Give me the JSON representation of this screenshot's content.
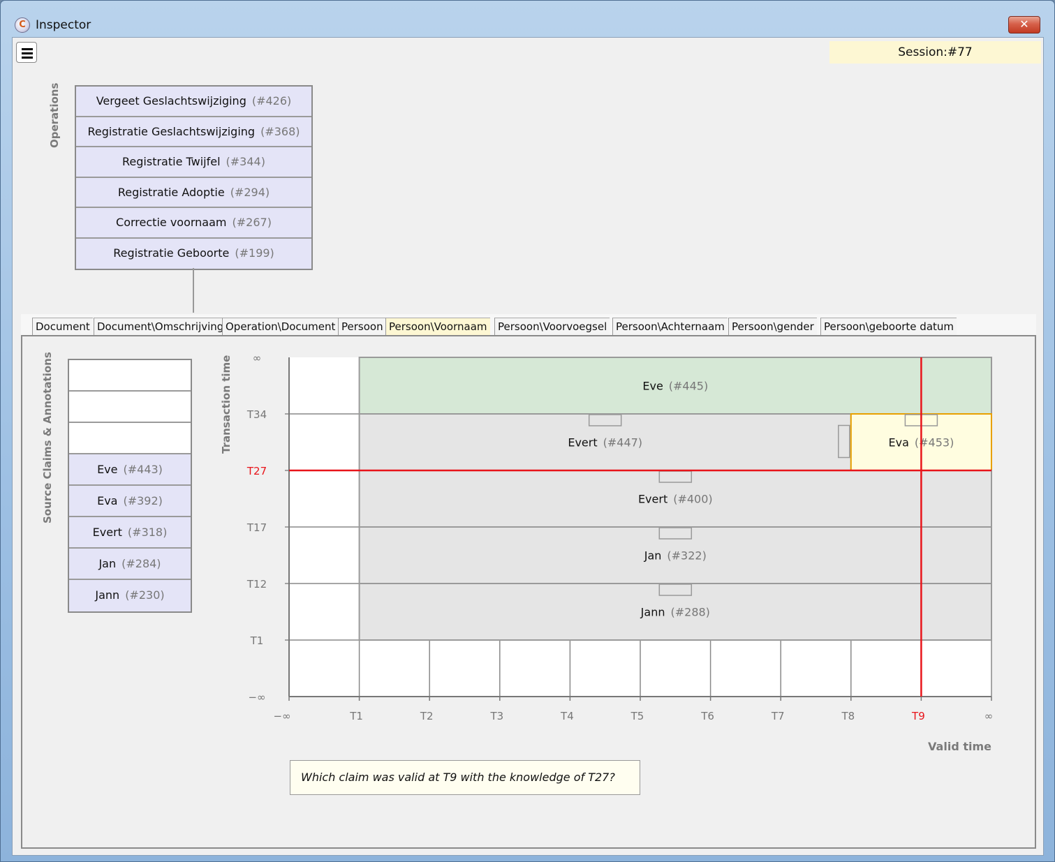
{
  "window": {
    "title": "Inspector",
    "app_icon_glyph": "C",
    "close_glyph": "✕"
  },
  "toolbar": {
    "menu_icon": "hamburger-menu-icon",
    "session": "Session:#77"
  },
  "operations": {
    "label": "Operations",
    "items": [
      {
        "name": "Vergeet Geslachtswijziging",
        "ref": "(#426)"
      },
      {
        "name": "Registratie Geslachtswijziging",
        "ref": "(#368)"
      },
      {
        "name": "Registratie Twijfel",
        "ref": "(#344)"
      },
      {
        "name": "Registratie Adoptie",
        "ref": "(#294)"
      },
      {
        "name": "Correctie voornaam",
        "ref": "(#267)"
      },
      {
        "name": "Registratie Geboorte",
        "ref": "(#199)"
      }
    ]
  },
  "tabs": [
    {
      "label": "Document",
      "active": false
    },
    {
      "label": "Document\\Omschrijving",
      "active": false
    },
    {
      "label": "Operation\\Document",
      "active": false
    },
    {
      "label": "Persoon",
      "active": false
    },
    {
      "label": "Persoon\\Voornaam",
      "active": true
    },
    {
      "label": "Persoon\\Voorvoegsel",
      "active": false
    },
    {
      "label": "Persoon\\Achternaam",
      "active": false
    },
    {
      "label": "Persoon\\gender",
      "active": false
    },
    {
      "label": "Persoon\\geboorte datum",
      "active": false
    }
  ],
  "source_claims": {
    "label": "Source Claims & Annotations",
    "items": [
      {
        "name": "",
        "ref": ""
      },
      {
        "name": "",
        "ref": ""
      },
      {
        "name": "",
        "ref": ""
      },
      {
        "name": "Eve",
        "ref": "(#443)"
      },
      {
        "name": "Eva",
        "ref": "(#392)"
      },
      {
        "name": "Evert",
        "ref": "(#318)"
      },
      {
        "name": "Jan",
        "ref": "(#284)"
      },
      {
        "name": "Jann",
        "ref": "(#230)"
      }
    ]
  },
  "colors": {
    "highlight": "#e8141a",
    "green_band": "#d6e8d6",
    "grey_band": "#e5e5e5",
    "selected_band": "#fffde0",
    "selected_border": "#e8a000"
  },
  "chart_data": {
    "type": "bitemporal-timeline",
    "xlabel": "Valid time",
    "ylabel": "Transaction time",
    "x_ticks": [
      "−∞",
      "T1",
      "T2",
      "T3",
      "T4",
      "T5",
      "T6",
      "T7",
      "T8",
      "T9",
      "∞"
    ],
    "y_ticks": [
      "−∞",
      "T1",
      "T12",
      "T17",
      "T27",
      "T34",
      "∞"
    ],
    "highlight_x": "T9",
    "highlight_y": "T27",
    "claims": [
      {
        "name": "Eve",
        "ref": "(#445)",
        "valid_from": "T1",
        "valid_to": "∞",
        "tx_from": "T34",
        "tx_to": "∞",
        "style": "green"
      },
      {
        "name": "Evert",
        "ref": "(#447)",
        "valid_from": "T1",
        "valid_to": "T8",
        "tx_from": "T27",
        "tx_to": "T34",
        "style": "grey"
      },
      {
        "name": "Eva",
        "ref": "(#453)",
        "valid_from": "T8",
        "valid_to": "∞",
        "tx_from": "T27",
        "tx_to": "T34",
        "style": "selected"
      },
      {
        "name": "Evert",
        "ref": "(#400)",
        "valid_from": "T1",
        "valid_to": "∞",
        "tx_from": "T17",
        "tx_to": "T27",
        "style": "grey"
      },
      {
        "name": "Jan",
        "ref": "(#322)",
        "valid_from": "T1",
        "valid_to": "∞",
        "tx_from": "T12",
        "tx_to": "T17",
        "style": "grey"
      },
      {
        "name": "Jann",
        "ref": "(#288)",
        "valid_from": "T1",
        "valid_to": "∞",
        "tx_from": "T1",
        "tx_to": "T12",
        "style": "grey"
      }
    ]
  },
  "question": "Which claim was valid at T9 with the knowledge of T27?"
}
